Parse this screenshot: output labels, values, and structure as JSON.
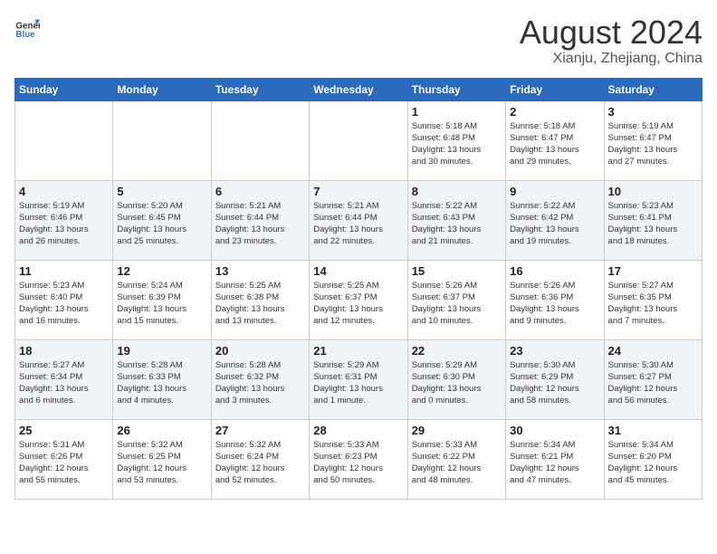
{
  "logo": {
    "text_general": "General",
    "text_blue": "Blue"
  },
  "header": {
    "month_year": "August 2024",
    "location": "Xianju, Zhejiang, China"
  },
  "days_of_week": [
    "Sunday",
    "Monday",
    "Tuesday",
    "Wednesday",
    "Thursday",
    "Friday",
    "Saturday"
  ],
  "weeks": [
    [
      {
        "day": "",
        "info": ""
      },
      {
        "day": "",
        "info": ""
      },
      {
        "day": "",
        "info": ""
      },
      {
        "day": "",
        "info": ""
      },
      {
        "day": "1",
        "info": "Sunrise: 5:18 AM\nSunset: 6:48 PM\nDaylight: 13 hours\nand 30 minutes."
      },
      {
        "day": "2",
        "info": "Sunrise: 5:18 AM\nSunset: 6:47 PM\nDaylight: 13 hours\nand 29 minutes."
      },
      {
        "day": "3",
        "info": "Sunrise: 5:19 AM\nSunset: 6:47 PM\nDaylight: 13 hours\nand 27 minutes."
      }
    ],
    [
      {
        "day": "4",
        "info": "Sunrise: 5:19 AM\nSunset: 6:46 PM\nDaylight: 13 hours\nand 26 minutes."
      },
      {
        "day": "5",
        "info": "Sunrise: 5:20 AM\nSunset: 6:45 PM\nDaylight: 13 hours\nand 25 minutes."
      },
      {
        "day": "6",
        "info": "Sunrise: 5:21 AM\nSunset: 6:44 PM\nDaylight: 13 hours\nand 23 minutes."
      },
      {
        "day": "7",
        "info": "Sunrise: 5:21 AM\nSunset: 6:44 PM\nDaylight: 13 hours\nand 22 minutes."
      },
      {
        "day": "8",
        "info": "Sunrise: 5:22 AM\nSunset: 6:43 PM\nDaylight: 13 hours\nand 21 minutes."
      },
      {
        "day": "9",
        "info": "Sunrise: 5:22 AM\nSunset: 6:42 PM\nDaylight: 13 hours\nand 19 minutes."
      },
      {
        "day": "10",
        "info": "Sunrise: 5:23 AM\nSunset: 6:41 PM\nDaylight: 13 hours\nand 18 minutes."
      }
    ],
    [
      {
        "day": "11",
        "info": "Sunrise: 5:23 AM\nSunset: 6:40 PM\nDaylight: 13 hours\nand 16 minutes."
      },
      {
        "day": "12",
        "info": "Sunrise: 5:24 AM\nSunset: 6:39 PM\nDaylight: 13 hours\nand 15 minutes."
      },
      {
        "day": "13",
        "info": "Sunrise: 5:25 AM\nSunset: 6:38 PM\nDaylight: 13 hours\nand 13 minutes."
      },
      {
        "day": "14",
        "info": "Sunrise: 5:25 AM\nSunset: 6:37 PM\nDaylight: 13 hours\nand 12 minutes."
      },
      {
        "day": "15",
        "info": "Sunrise: 5:26 AM\nSunset: 6:37 PM\nDaylight: 13 hours\nand 10 minutes."
      },
      {
        "day": "16",
        "info": "Sunrise: 5:26 AM\nSunset: 6:36 PM\nDaylight: 13 hours\nand 9 minutes."
      },
      {
        "day": "17",
        "info": "Sunrise: 5:27 AM\nSunset: 6:35 PM\nDaylight: 13 hours\nand 7 minutes."
      }
    ],
    [
      {
        "day": "18",
        "info": "Sunrise: 5:27 AM\nSunset: 6:34 PM\nDaylight: 13 hours\nand 6 minutes."
      },
      {
        "day": "19",
        "info": "Sunrise: 5:28 AM\nSunset: 6:33 PM\nDaylight: 13 hours\nand 4 minutes."
      },
      {
        "day": "20",
        "info": "Sunrise: 5:28 AM\nSunset: 6:32 PM\nDaylight: 13 hours\nand 3 minutes."
      },
      {
        "day": "21",
        "info": "Sunrise: 5:29 AM\nSunset: 6:31 PM\nDaylight: 13 hours\nand 1 minute."
      },
      {
        "day": "22",
        "info": "Sunrise: 5:29 AM\nSunset: 6:30 PM\nDaylight: 13 hours\nand 0 minutes."
      },
      {
        "day": "23",
        "info": "Sunrise: 5:30 AM\nSunset: 6:29 PM\nDaylight: 12 hours\nand 58 minutes."
      },
      {
        "day": "24",
        "info": "Sunrise: 5:30 AM\nSunset: 6:27 PM\nDaylight: 12 hours\nand 56 minutes."
      }
    ],
    [
      {
        "day": "25",
        "info": "Sunrise: 5:31 AM\nSunset: 6:26 PM\nDaylight: 12 hours\nand 55 minutes."
      },
      {
        "day": "26",
        "info": "Sunrise: 5:32 AM\nSunset: 6:25 PM\nDaylight: 12 hours\nand 53 minutes."
      },
      {
        "day": "27",
        "info": "Sunrise: 5:32 AM\nSunset: 6:24 PM\nDaylight: 12 hours\nand 52 minutes."
      },
      {
        "day": "28",
        "info": "Sunrise: 5:33 AM\nSunset: 6:23 PM\nDaylight: 12 hours\nand 50 minutes."
      },
      {
        "day": "29",
        "info": "Sunrise: 5:33 AM\nSunset: 6:22 PM\nDaylight: 12 hours\nand 48 minutes."
      },
      {
        "day": "30",
        "info": "Sunrise: 5:34 AM\nSunset: 6:21 PM\nDaylight: 12 hours\nand 47 minutes."
      },
      {
        "day": "31",
        "info": "Sunrise: 5:34 AM\nSunset: 6:20 PM\nDaylight: 12 hours\nand 45 minutes."
      }
    ]
  ]
}
